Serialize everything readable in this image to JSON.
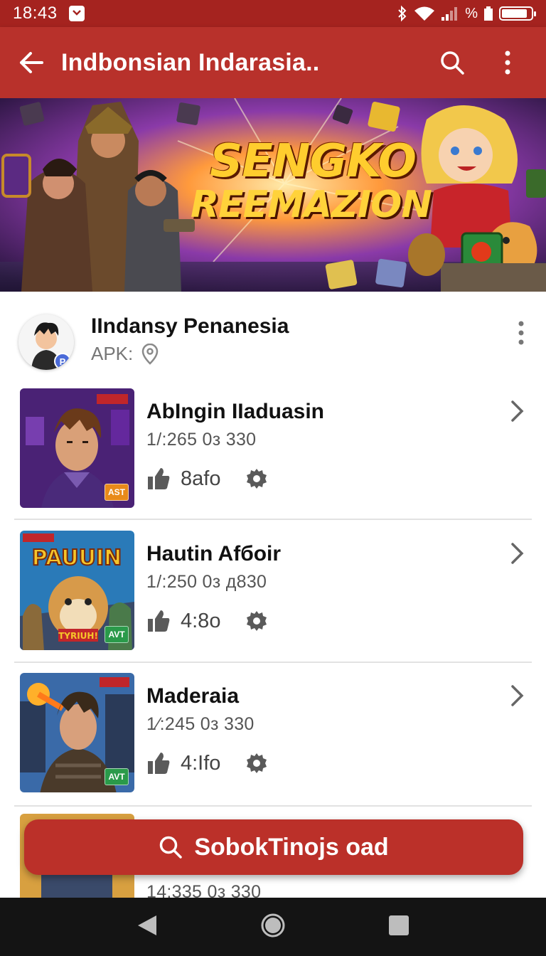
{
  "status_bar": {
    "time": "18:43",
    "percent_symbol": "%"
  },
  "app_bar": {
    "title": "Indbonsian Indarasia.."
  },
  "banner": {
    "title_line1": "SENGKO",
    "title_line2": "REEMAZION"
  },
  "profile": {
    "name": "IIndansy Penanesia",
    "subtitle": "APK:",
    "avatar_badge": "P"
  },
  "games": [
    {
      "title": "AbIngin IIaduasin",
      "meta": "1/:265 0з 330",
      "likes": "8afo",
      "badge": "AST",
      "tag": "© ≡≡"
    },
    {
      "title": "Hautin Afбoir",
      "meta": "1/:250 0з д830",
      "likes": "4:8o",
      "badge": "AVT",
      "tag": "© ≡≡"
    },
    {
      "title": "Maderaia",
      "meta": "1∕:245 0з 330",
      "likes": "4:Ifo",
      "badge": "AVT",
      "tag": "© ≡≡"
    },
    {
      "meta": "14:335 0з 330"
    }
  ],
  "game2_cover_text": "PAUUIN",
  "game2_cover_subtext": "TYRIUH!",
  "fab": {
    "label": "SobokTinojs oad"
  },
  "colors": {
    "primary": "#b8312b",
    "status": "#a5231f",
    "navbar": "#141414"
  }
}
